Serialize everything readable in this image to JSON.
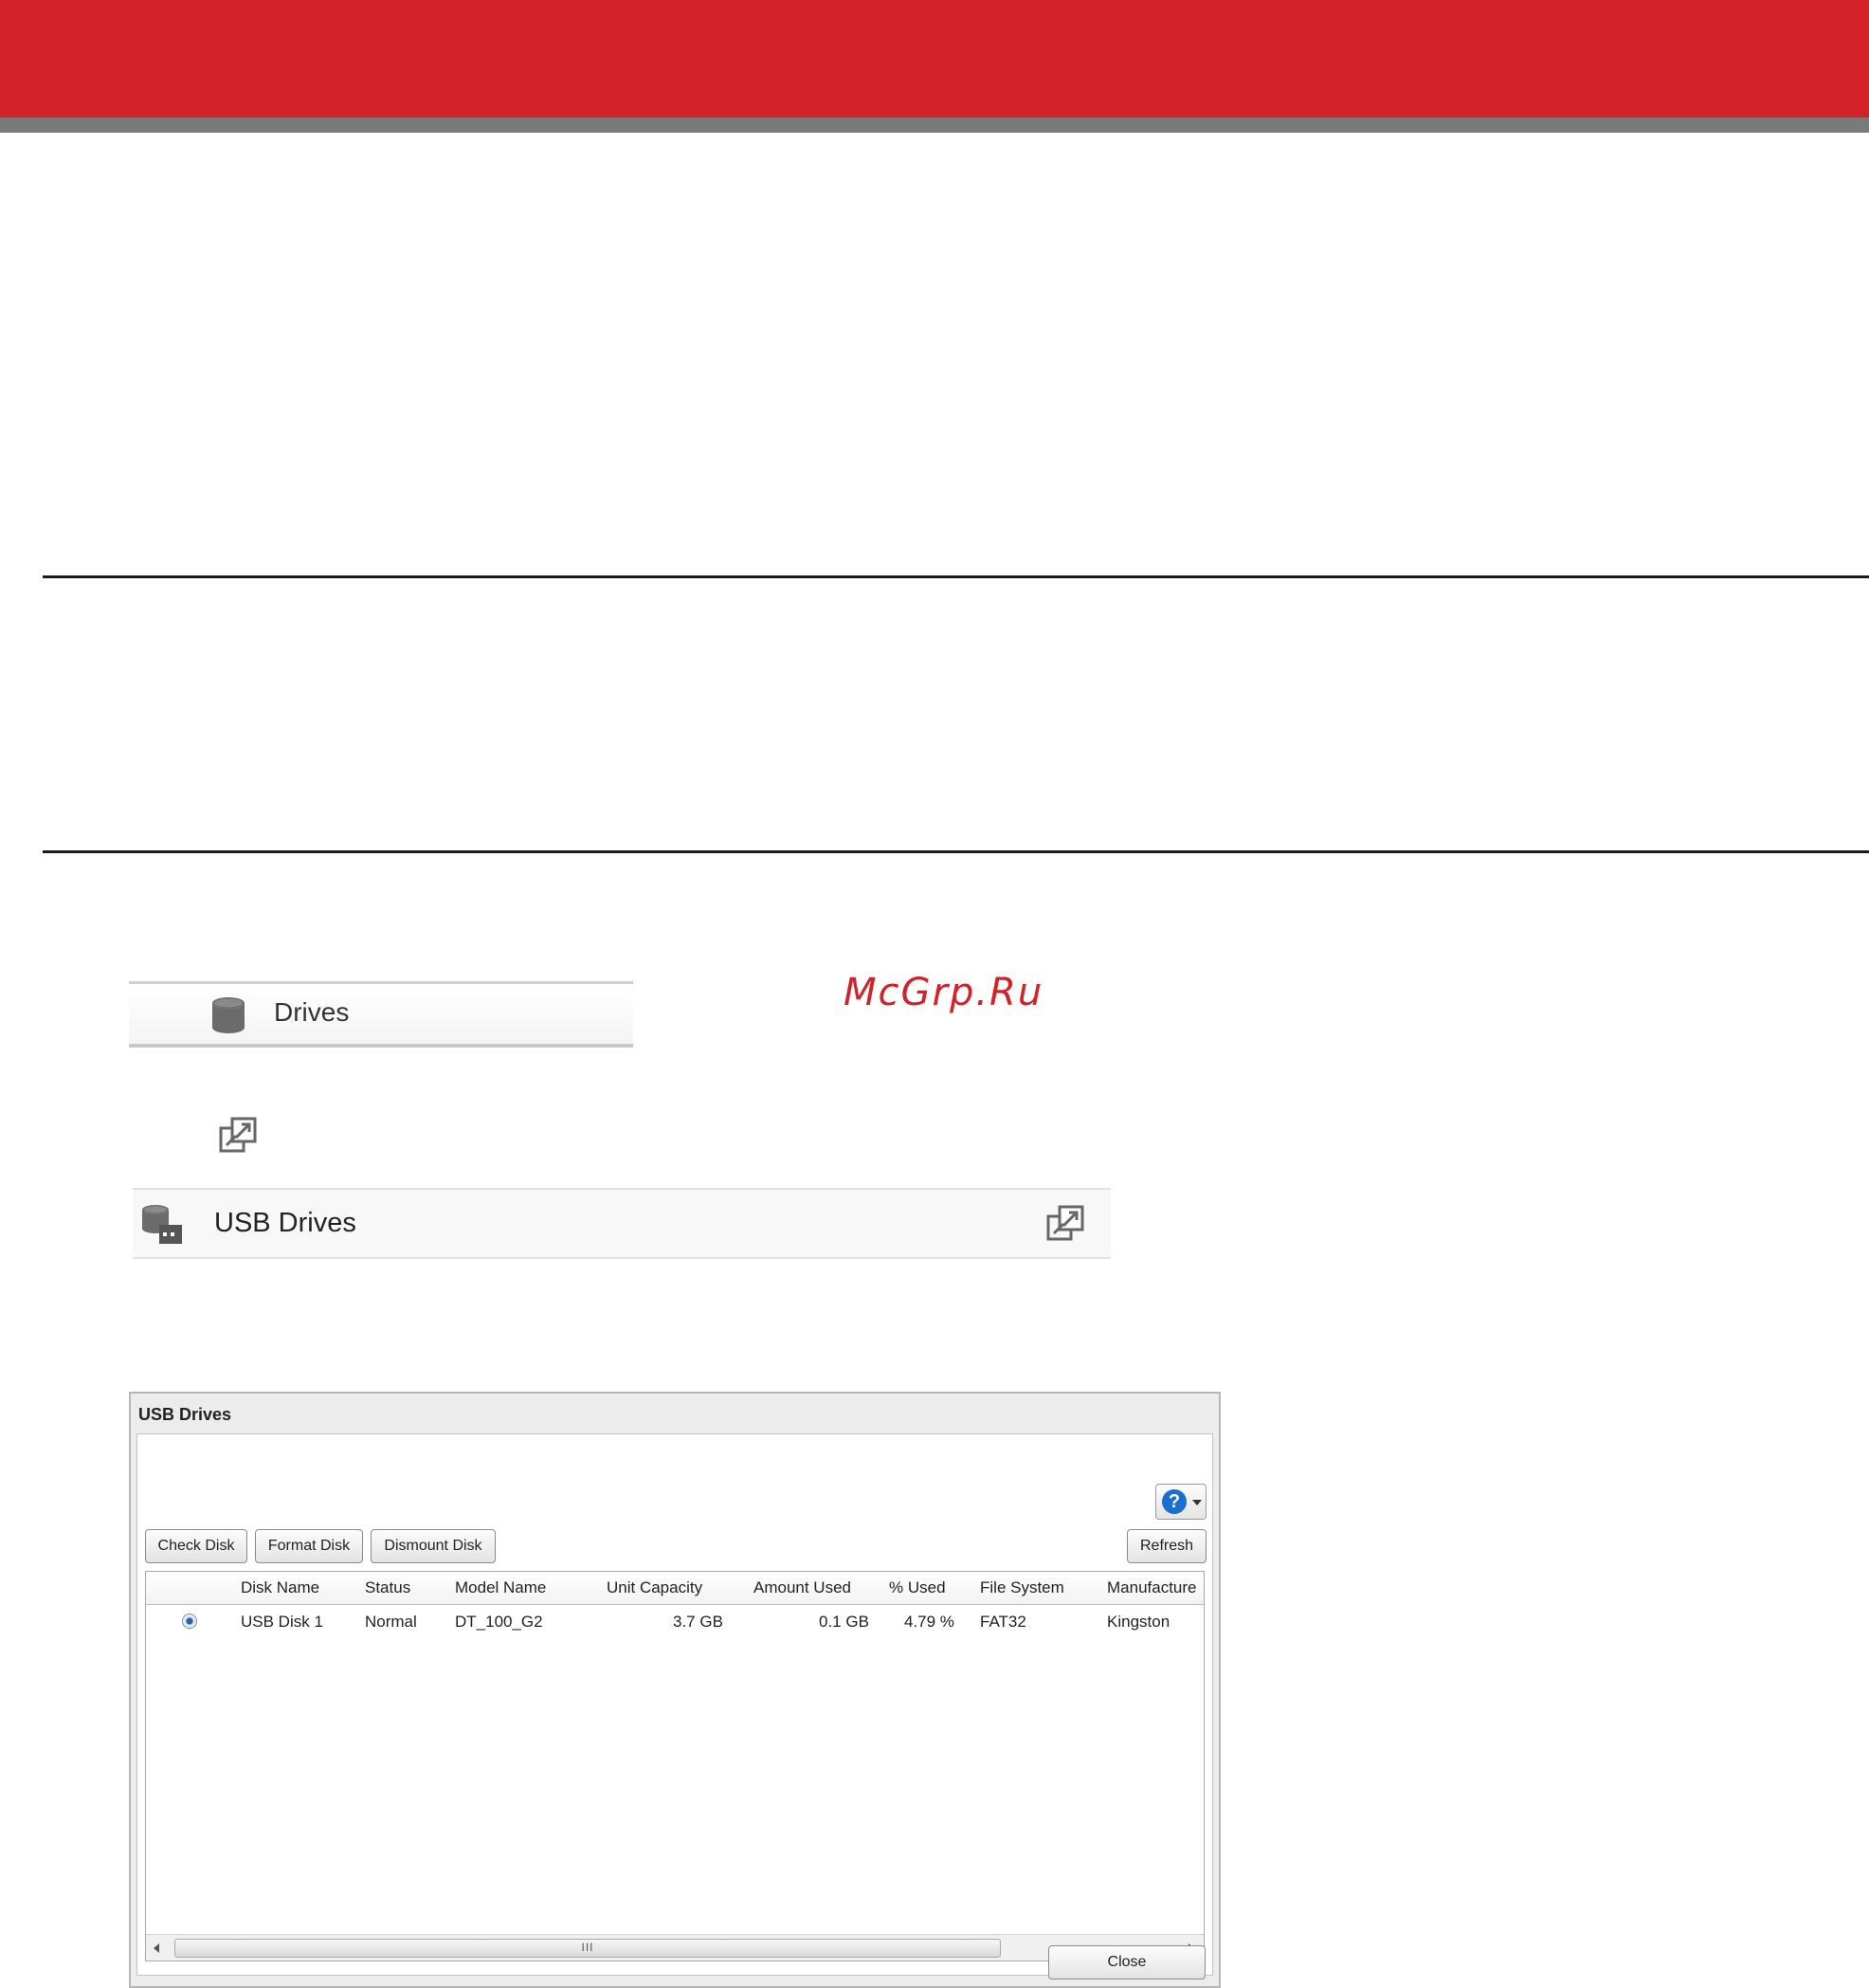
{
  "watermark": "McGrp.Ru",
  "drives_menu": {
    "label": "Drives",
    "icon": "database-icon"
  },
  "usb_bar": {
    "label": "USB Drives",
    "icon": "usb-drive-icon",
    "expand_icon": "expand-icon"
  },
  "dialog": {
    "title": "USB Drives",
    "help_icon": "help-icon",
    "toolbar": {
      "check_disk": "Check Disk",
      "format_disk": "Format Disk",
      "dismount_disk": "Dismount Disk",
      "refresh": "Refresh"
    },
    "table": {
      "columns": [
        "Disk Name",
        "Status",
        "Model Name",
        "Unit Capacity",
        "Amount Used",
        "% Used",
        "File System",
        "Manufacture"
      ],
      "rows": [
        {
          "selected": true,
          "disk_name": "USB Disk 1",
          "status": "Normal",
          "model_name": "DT_100_G2",
          "unit_capacity": "3.7 GB",
          "amount_used": "0.1 GB",
          "percent_used": "4.79 %",
          "file_system": "FAT32",
          "manufacturer": "Kingston"
        }
      ]
    },
    "scroll_grip": "III",
    "close_label": "Close"
  },
  "colors": {
    "banner_red": "#d42027",
    "banner_gray": "#7a7a7a",
    "help_blue": "#1a6fd0"
  }
}
